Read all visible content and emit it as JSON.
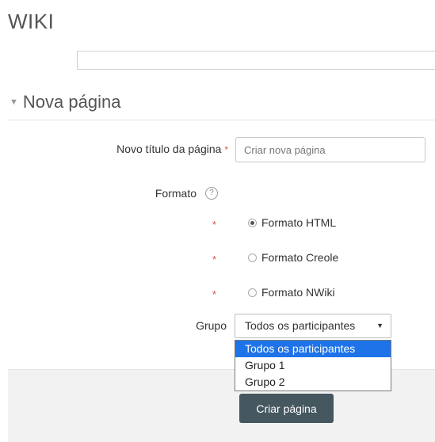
{
  "page": {
    "title": "WIKI"
  },
  "section": {
    "title": "Nova página"
  },
  "form": {
    "title_label": "Novo título da página",
    "required_marker": "*",
    "title_placeholder": "Criar nova página",
    "format_label": "Formato",
    "help_symbol": "?",
    "format_options": [
      {
        "label": "Formato HTML",
        "checked": true
      },
      {
        "label": "Formato Creole",
        "checked": false
      },
      {
        "label": "Formato NWiki",
        "checked": false
      }
    ],
    "group_label": "Grupo",
    "group_selected": "Todos os participantes",
    "group_options": [
      "Todos os participantes",
      "Grupo 1",
      "Grupo 2"
    ],
    "submit_label": "Criar página"
  },
  "colors": {
    "required": "#d9534f",
    "selected_option": "#1e73e8",
    "button": "#45575f"
  }
}
